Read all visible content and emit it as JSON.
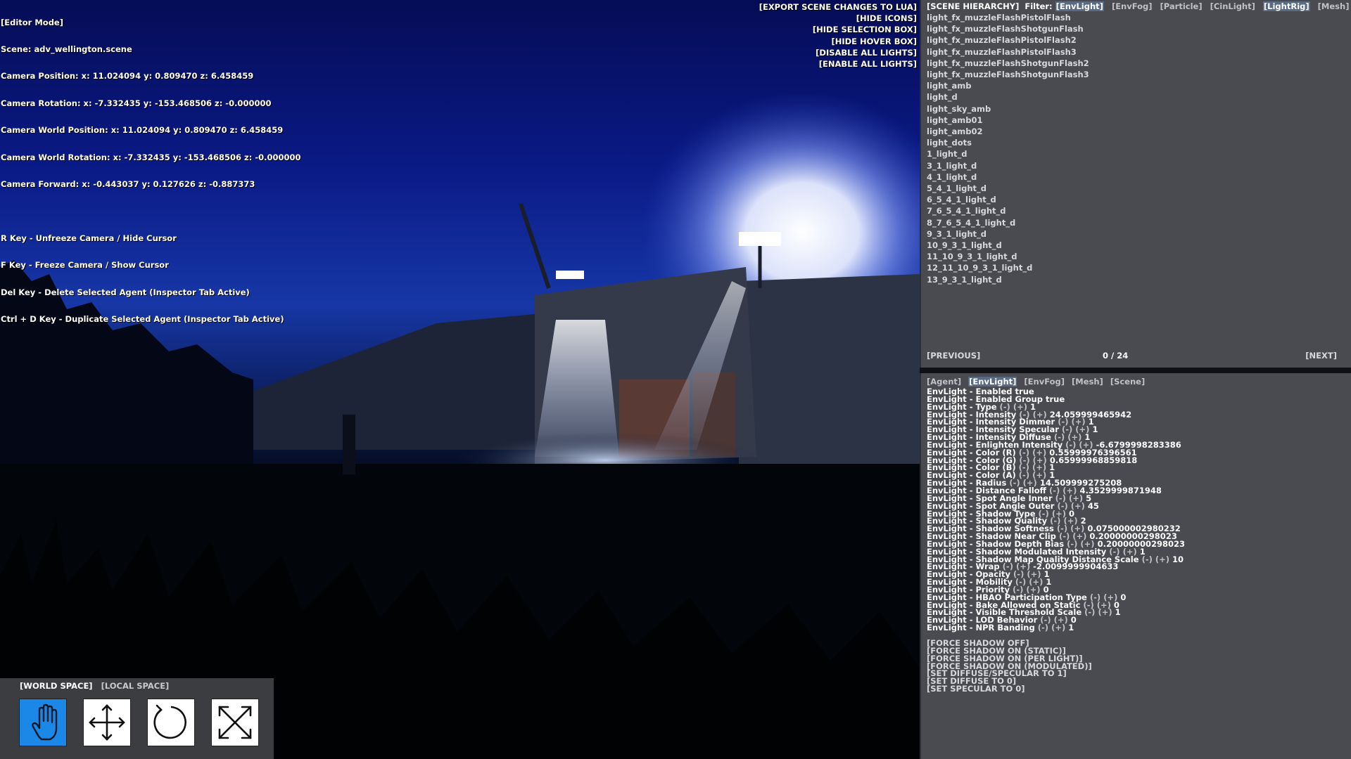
{
  "editor_info": {
    "lines": [
      "[Editor Mode]",
      "Scene: adv_wellington.scene",
      "Camera Position: x: 11.024094 y: 0.809470 z: 6.458459",
      "Camera Rotation: x: -7.332435 y: -153.468506 z: -0.000000",
      "Camera World Position: x: 11.024094 y: 0.809470 z: 6.458459",
      "Camera World Rotation: x: -7.332435 y: -153.468506 z: -0.000000",
      "Camera Forward: x: -0.443037 y: 0.127626 z: -0.887373"
    ],
    "hints": [
      "R Key - Unfreeze Camera / Hide Cursor",
      "F Key - Freeze Camera / Show Cursor",
      "Del Key - Delete Selected Agent (Inspector Tab Active)",
      "Ctrl + D Key - Duplicate Selected Agent (Inspector Tab Active)"
    ]
  },
  "viewport_actions": [
    "[EXPORT SCENE CHANGES TO LUA]",
    "[HIDE ICONS]",
    "[HIDE SELECTION BOX]",
    "[HIDE HOVER BOX]",
    "[DISABLE ALL LIGHTS]",
    "[ENABLE ALL LIGHTS]"
  ],
  "transform_panel": {
    "space_tabs": [
      {
        "label": "[WORLD SPACE]",
        "active": true
      },
      {
        "label": "[LOCAL SPACE]",
        "active": false
      }
    ],
    "tools": [
      {
        "icon": "hand-icon",
        "active": true
      },
      {
        "icon": "move-icon",
        "active": false
      },
      {
        "icon": "rotate-icon",
        "active": false
      },
      {
        "icon": "scale-icon",
        "active": false
      }
    ],
    "active_color": "#1b88e8"
  },
  "hierarchy": {
    "title": "[SCENE HIERARCHY]",
    "filter_label": "Filter:",
    "filters": [
      {
        "label": "[EnvLight]",
        "active": true
      },
      {
        "label": "[EnvFog]",
        "active": false
      },
      {
        "label": "[Particle]",
        "active": false
      },
      {
        "label": "[CinLight]",
        "active": false
      },
      {
        "label": "[LightRig]",
        "active": true
      },
      {
        "label": "[Mesh]",
        "active": false
      }
    ],
    "items": [
      "light_fx_muzzleFlashPistolFlash",
      "light_fx_muzzleFlashShotgunFlash",
      "light_fx_muzzleFlashPistolFlash2",
      "light_fx_muzzleFlashPistolFlash3",
      "light_fx_muzzleFlashShotgunFlash2",
      "light_fx_muzzleFlashShotgunFlash3",
      "light_amb",
      "light_d",
      "light_sky_amb",
      "light_amb01",
      "light_amb02",
      "light_dots",
      "1_light_d",
      "3_1_light_d",
      "4_1_light_d",
      "5_4_1_light_d",
      "6_5_4_1_light_d",
      "7_6_5_4_1_light_d",
      "8_7_6_5_4_1_light_d",
      "9_3_1_light_d",
      "10_9_3_1_light_d",
      "11_10_9_3_1_light_d",
      "12_11_10_9_3_1_light_d",
      "13_9_3_1_light_d"
    ],
    "prev_label": "[PREVIOUS]",
    "page_count": "0 / 24",
    "next_label": "[NEXT]"
  },
  "inspector": {
    "tabs": [
      {
        "label": "[Agent]",
        "active": false
      },
      {
        "label": "[EnvLight]",
        "active": true
      },
      {
        "label": "[EnvFog]",
        "active": false
      },
      {
        "label": "[Mesh]",
        "active": false
      },
      {
        "label": "[Scene]",
        "active": false
      }
    ],
    "properties": [
      {
        "name": "EnvLight - Enabled",
        "value": "true",
        "step": false
      },
      {
        "name": "EnvLight - Enabled Group",
        "value": "true",
        "step": false
      },
      {
        "name": "EnvLight - Type",
        "value": "1",
        "step": true
      },
      {
        "name": "EnvLight - Intensity",
        "value": "24.059999465942",
        "step": true
      },
      {
        "name": "EnvLight - Intensity Dimmer",
        "value": "1",
        "step": true
      },
      {
        "name": "EnvLight - Intensity Specular",
        "value": "1",
        "step": true
      },
      {
        "name": "EnvLight - Intensity Diffuse",
        "value": "1",
        "step": true
      },
      {
        "name": "EnvLight - Enlighten Intensity",
        "value": "-6.6799998283386",
        "step": true
      },
      {
        "name": "EnvLight - Color (R)",
        "value": "0.55999976396561",
        "step": true
      },
      {
        "name": "EnvLight - Color (G)",
        "value": "0.65999968859818",
        "step": true
      },
      {
        "name": "EnvLight - Color (B)",
        "value": "1",
        "step": true
      },
      {
        "name": "EnvLight - Color (A)",
        "value": "1",
        "step": true
      },
      {
        "name": "EnvLight - Radius",
        "value": "14.509999275208",
        "step": true
      },
      {
        "name": "EnvLight - Distance Falloff",
        "value": "4.3529999871948",
        "step": true
      },
      {
        "name": "EnvLight - Spot Angle Inner",
        "value": "5",
        "step": true
      },
      {
        "name": "EnvLight - Spot Angle Outer",
        "value": "45",
        "step": true
      },
      {
        "name": "EnvLight - Shadow Type",
        "value": "0",
        "step": true
      },
      {
        "name": "EnvLight - Shadow Quality",
        "value": "2",
        "step": true
      },
      {
        "name": "EnvLight - Shadow Softness",
        "value": "0.075000002980232",
        "step": true
      },
      {
        "name": "EnvLight - Shadow Near Clip",
        "value": "0.20000000298023",
        "step": true
      },
      {
        "name": "EnvLight - Shadow Depth Bias",
        "value": "0.20000000298023",
        "step": true
      },
      {
        "name": "EnvLight - Shadow Modulated Intensity",
        "value": "1",
        "step": true
      },
      {
        "name": "EnvLight - Shadow Map Quality Distance Scale",
        "value": "10",
        "step": true
      },
      {
        "name": "EnvLight - Wrap",
        "value": "-2.0099999904633",
        "step": true
      },
      {
        "name": "EnvLight - Opacity",
        "value": "1",
        "step": true
      },
      {
        "name": "EnvLight - Mobility",
        "value": "1",
        "step": true
      },
      {
        "name": "EnvLight - Priority",
        "value": "0",
        "step": true
      },
      {
        "name": "EnvLight - HBAO Participation Type",
        "value": "0",
        "step": true
      },
      {
        "name": "EnvLight - Bake Allowed on Static",
        "value": "0",
        "step": true
      },
      {
        "name": "EnvLight - Visible Threshold Scale",
        "value": "1",
        "step": true
      },
      {
        "name": "EnvLight - LOD Behavior",
        "value": "0",
        "step": true
      },
      {
        "name": "EnvLight - NPR Banding",
        "value": "1",
        "step": true
      }
    ],
    "minus_label": "(-)",
    "plus_label": "(+)",
    "actions": [
      "[FORCE SHADOW OFF]",
      "[FORCE SHADOW ON (STATIC)]",
      "[FORCE SHADOW ON (PER LIGHT)]",
      "[FORCE SHADOW ON (MODULATED)]",
      "[SET DIFFUSE/SPECULAR TO 1]",
      "[SET DIFFUSE TO 0]",
      "[SET SPECULAR TO 0]"
    ]
  }
}
